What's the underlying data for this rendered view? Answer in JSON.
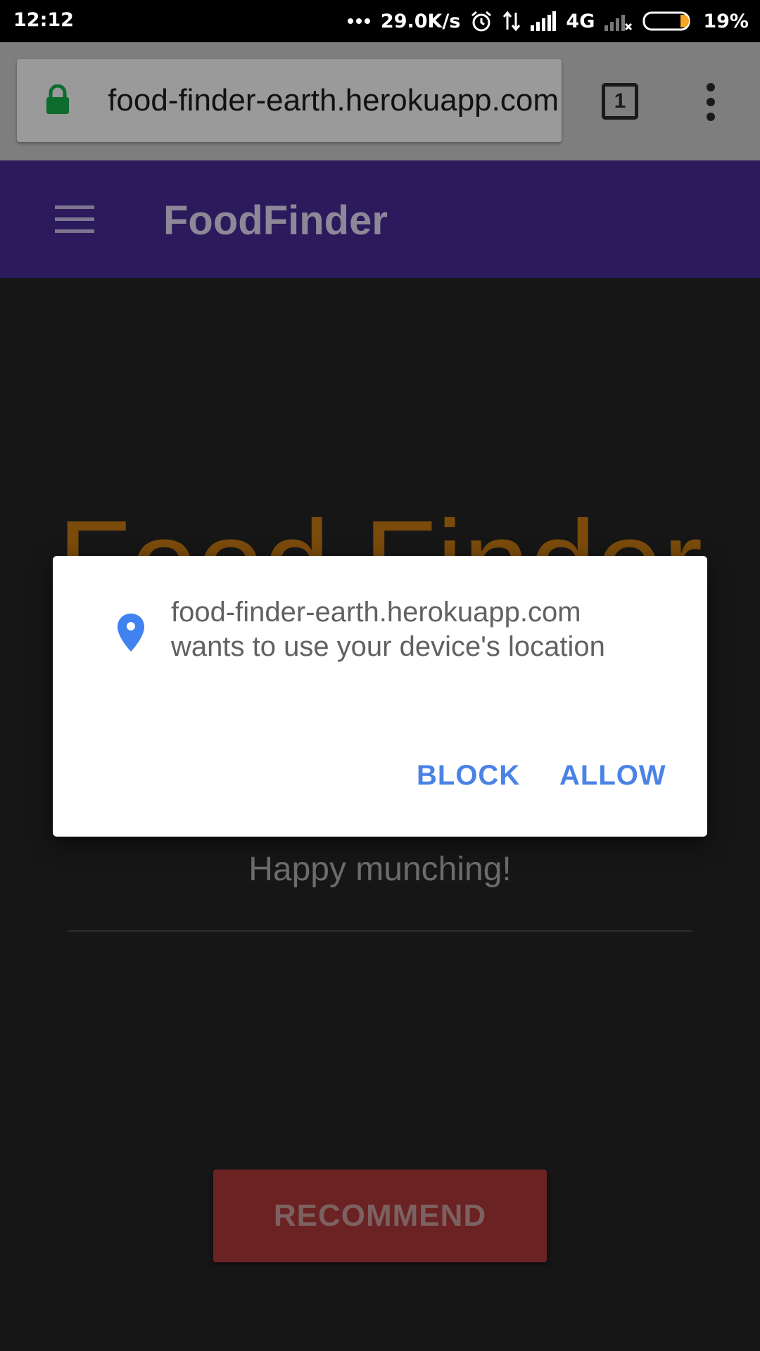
{
  "status_bar": {
    "time": "12:12",
    "speed": "29.0K/s",
    "network": "4G",
    "battery": "19%"
  },
  "browser": {
    "url": "food-finder-earth.herokuapp.com",
    "tab_count": "1"
  },
  "app_header": {
    "title": "FoodFinder"
  },
  "page": {
    "hero_title": "Food Finder",
    "tagline": "Happy munching!",
    "recommend_label": "RECOMMEND"
  },
  "permission_dialog": {
    "message_line1": "food-finder-earth.herokuapp.com",
    "message_line2": "wants to use your device's location",
    "block_label": "BLOCK",
    "allow_label": "ALLOW"
  },
  "colors": {
    "header": "#2b1a5c",
    "hero_title": "#7a4b0b",
    "recommend_button": "#6b2222",
    "dialog_accent": "#4a82e6"
  },
  "icons": [
    "lock-icon",
    "tab-switcher-icon",
    "more-vert-icon",
    "hamburger-menu-icon",
    "location-pin-icon",
    "alarm-icon",
    "signal-icon",
    "battery-icon"
  ]
}
